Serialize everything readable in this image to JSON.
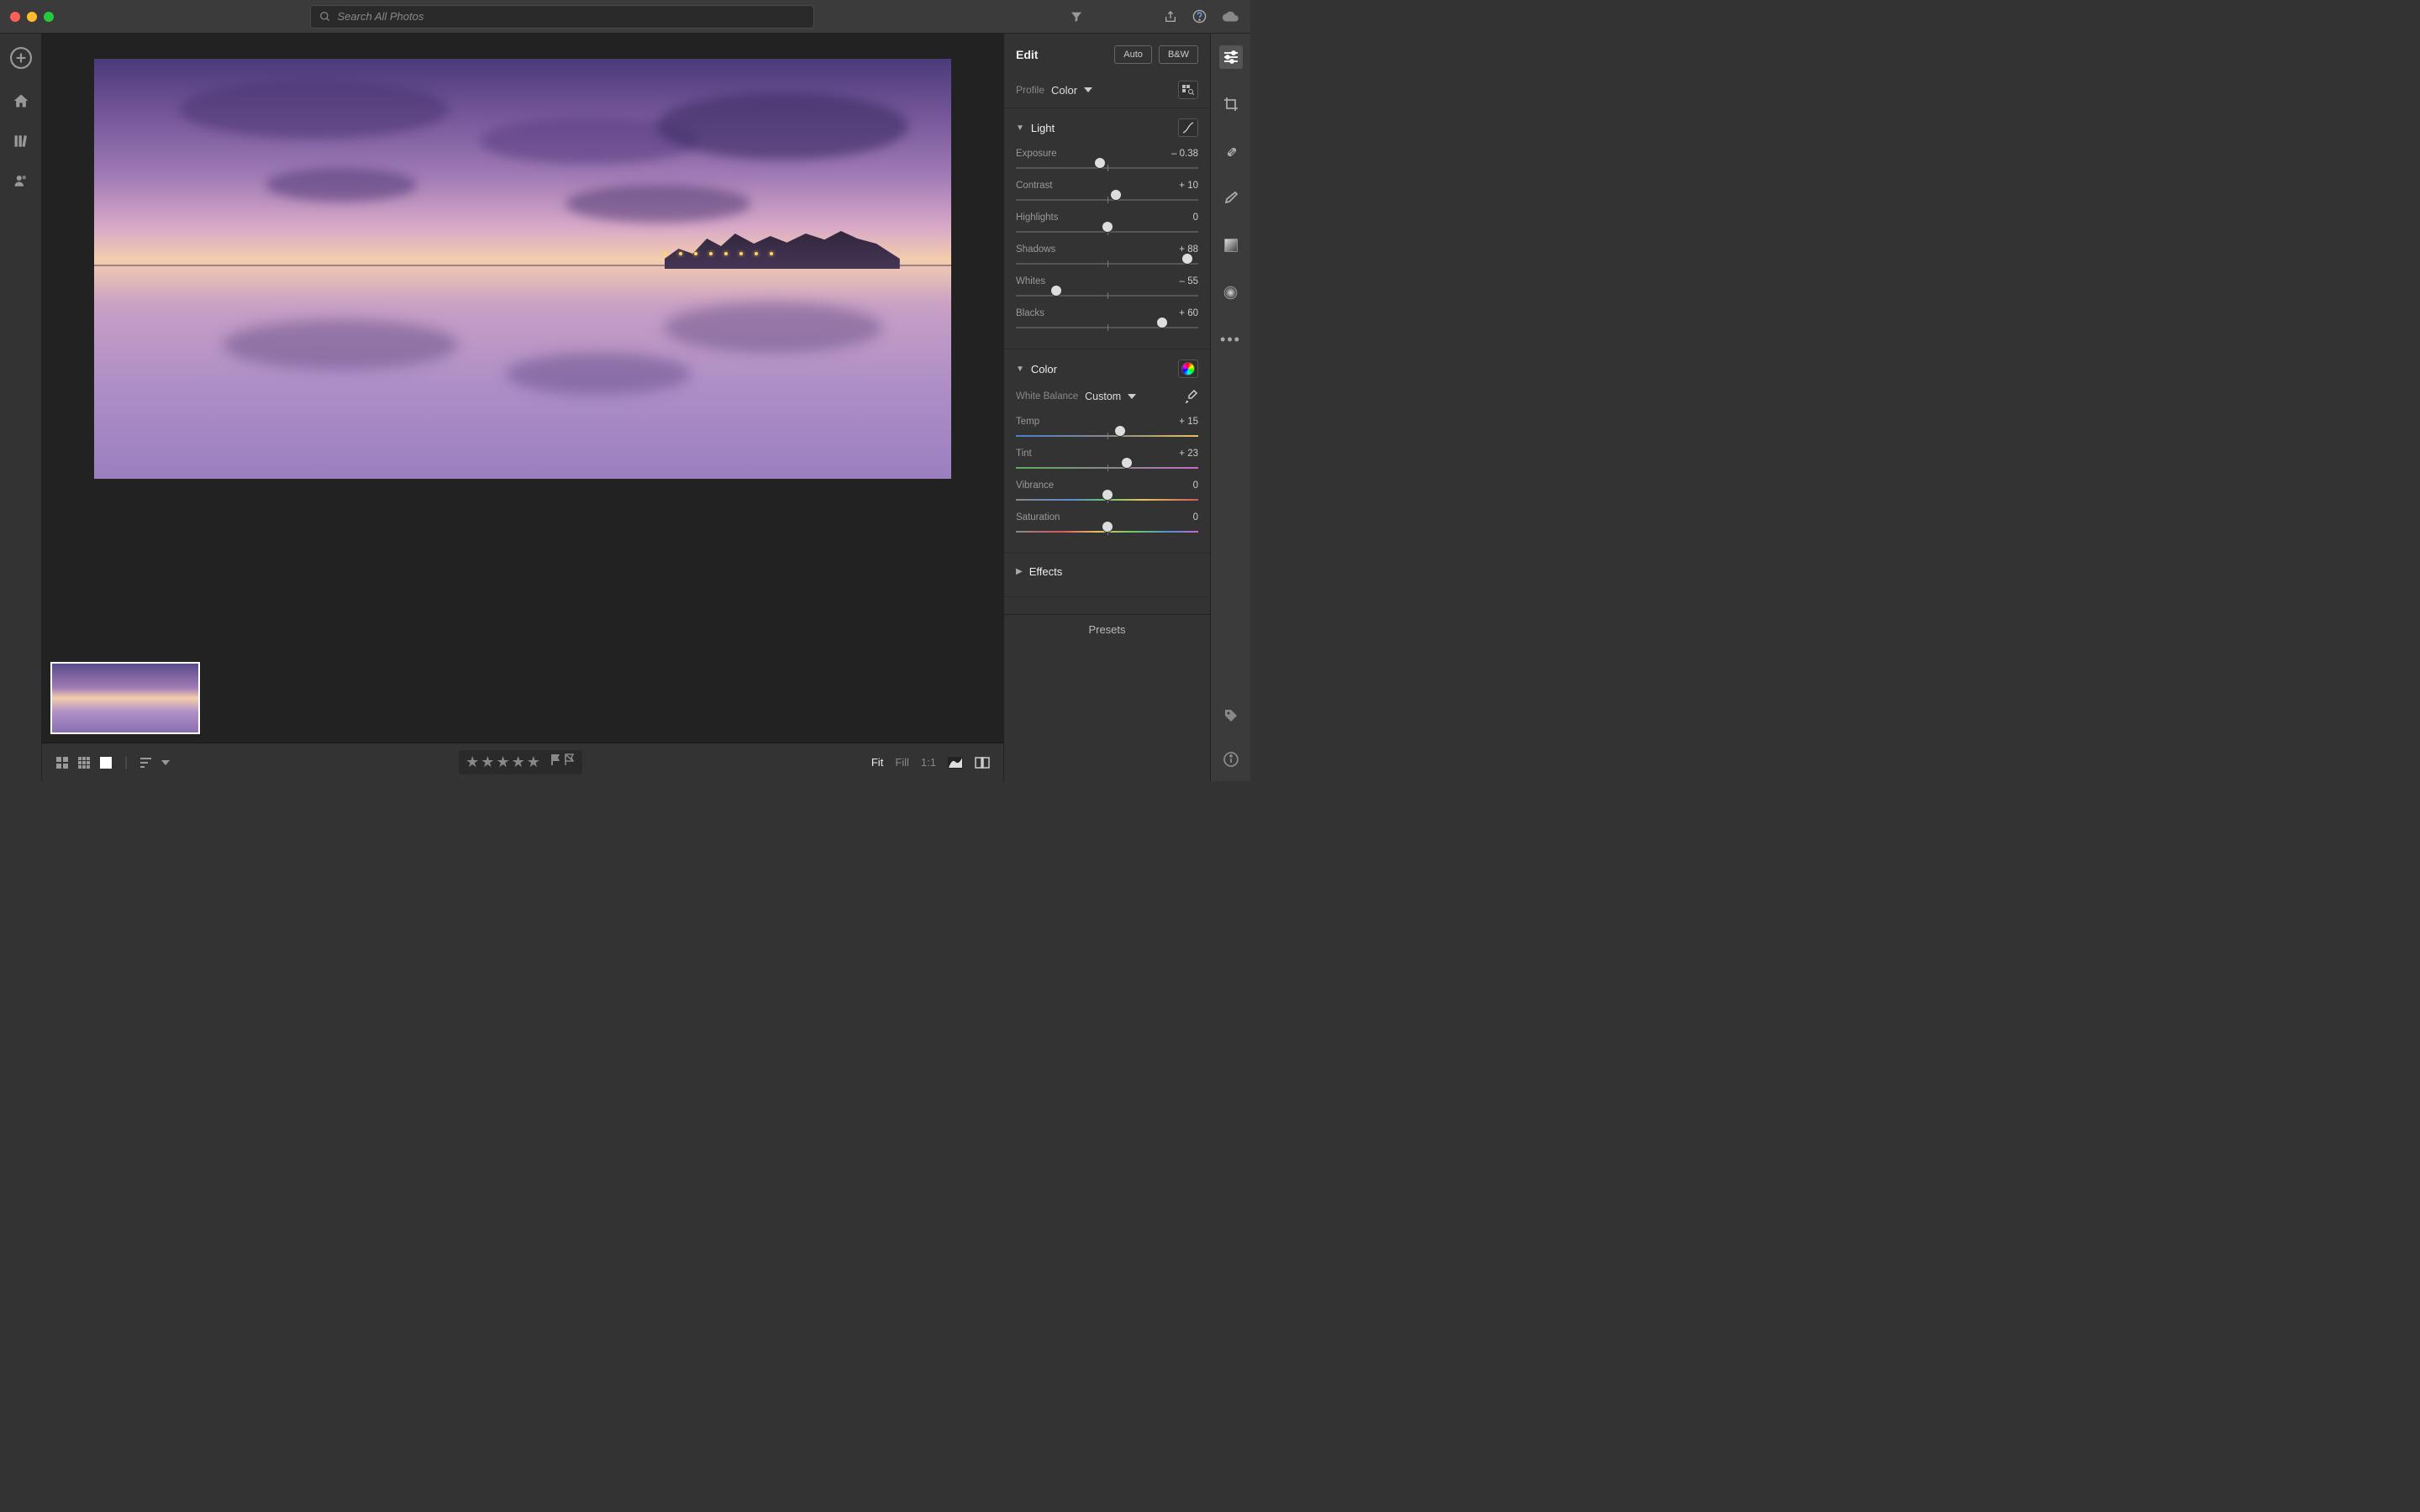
{
  "search": {
    "placeholder": "Search All Photos"
  },
  "edit": {
    "title": "Edit",
    "auto_label": "Auto",
    "bw_label": "B&W",
    "profile_label": "Profile",
    "profile_value": "Color",
    "presets_label": "Presets"
  },
  "light": {
    "title": "Light",
    "sliders": [
      {
        "label": "Exposure",
        "value": "– 0.38",
        "pos": 46
      },
      {
        "label": "Contrast",
        "value": "+ 10",
        "pos": 55
      },
      {
        "label": "Highlights",
        "value": "0",
        "pos": 50
      },
      {
        "label": "Shadows",
        "value": "+ 88",
        "pos": 94
      },
      {
        "label": "Whites",
        "value": "– 55",
        "pos": 22
      },
      {
        "label": "Blacks",
        "value": "+ 60",
        "pos": 80
      }
    ]
  },
  "color": {
    "title": "Color",
    "wb_label": "White Balance",
    "wb_value": "Custom",
    "sliders": [
      {
        "label": "Temp",
        "value": "+ 15",
        "pos": 57,
        "grad": "gradient-temp"
      },
      {
        "label": "Tint",
        "value": "+ 23",
        "pos": 61,
        "grad": "gradient-tint"
      },
      {
        "label": "Vibrance",
        "value": "0",
        "pos": 50,
        "grad": "gradient-vib"
      },
      {
        "label": "Saturation",
        "value": "0",
        "pos": 50,
        "grad": "gradient-sat"
      }
    ]
  },
  "effects": {
    "title": "Effects"
  },
  "bottom": {
    "fit": "Fit",
    "fill": "Fill",
    "one": "1:1"
  }
}
